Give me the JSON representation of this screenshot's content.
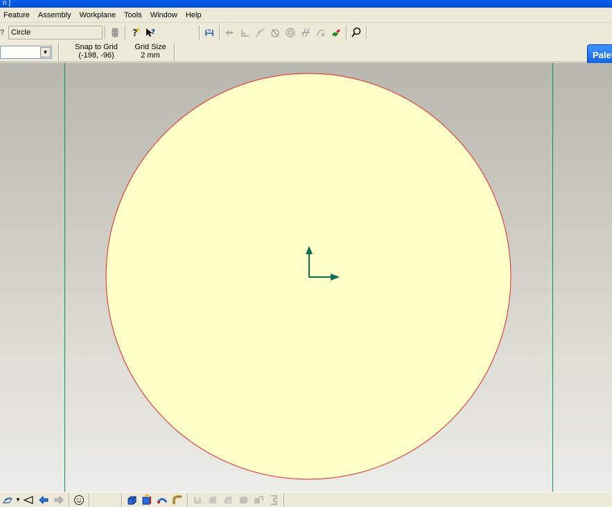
{
  "title": {
    "text": "n ]"
  },
  "menu": {
    "items": [
      {
        "label": "Feature"
      },
      {
        "label": "Assembly"
      },
      {
        "label": "Workplane"
      },
      {
        "label": "Tools"
      },
      {
        "label": "Window"
      },
      {
        "label": "Help"
      }
    ]
  },
  "toolbar": {
    "command_value": "Circle"
  },
  "status": {
    "snap_label": "Snap to Grid",
    "snap_value": "(-198, -96)",
    "grid_label": "Grid Size",
    "grid_value": "2 mm"
  },
  "palette": {
    "label": "Palet"
  },
  "sketch": {
    "shape": "Circle",
    "fill_color": "#ffffc8",
    "outline_color": "#e8202a",
    "axis_color": "#0a7050",
    "guide_color": "#138a5a"
  },
  "icons": {
    "toolbar": [
      "gear-icon",
      "help-icon",
      "whats-this-icon",
      "dimension-icon",
      "horizontal-constraint-icon",
      "perpendicular-icon",
      "tangent-icon",
      "coincident-icon",
      "concentric-icon",
      "parallel-icon",
      "fix-icon",
      "magnet-icon",
      "zoom-icon"
    ],
    "bottom": [
      "plane-icon",
      "triangle-icon",
      "back-arrow-icon",
      "forward-arrow-icon",
      "smiley-icon",
      "extrude-icon",
      "revolve-icon",
      "sweep-icon",
      "loft-icon",
      "shell-icon",
      "fillet-icon",
      "chamfer-icon",
      "draft-icon",
      "pattern-icon",
      "mirror-icon"
    ]
  }
}
